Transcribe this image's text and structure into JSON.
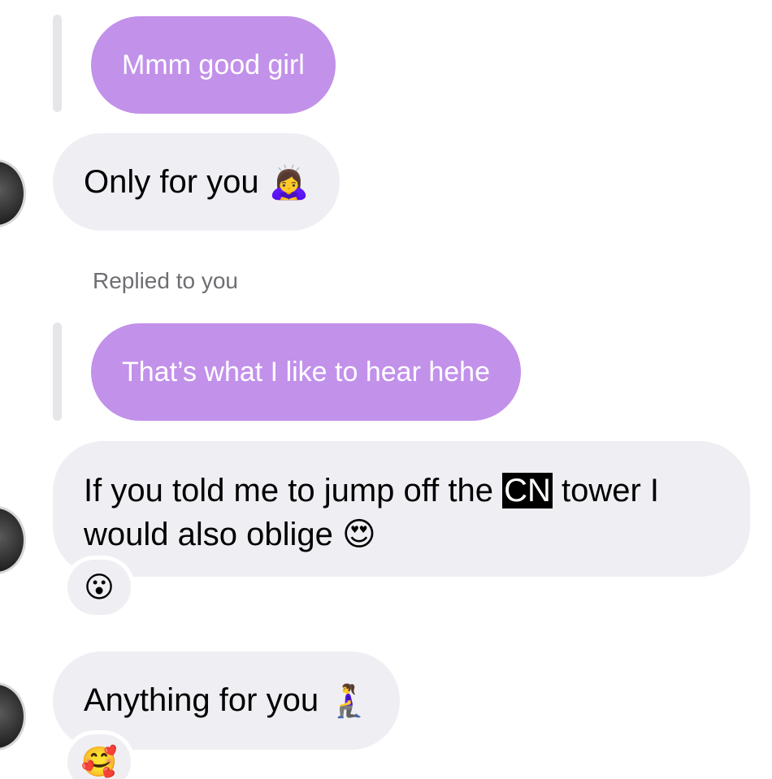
{
  "messages": {
    "quoted_1": {
      "text": "Mmm good girl"
    },
    "incoming_1": {
      "text": "Only for you",
      "emoji": "🙇‍♀️"
    },
    "reply_label": "Replied to you",
    "quoted_2": {
      "text": "That’s what I like to hear hehe"
    },
    "incoming_2": {
      "text_before": "If you told me to jump off the ",
      "highlight": "CN",
      "text_after": " tower I would also oblige ",
      "emoji": "😍",
      "reaction": "😮"
    },
    "incoming_3": {
      "text": "Anything for you",
      "emoji": "🧎‍♀️",
      "reaction": "🥰"
    }
  },
  "colors": {
    "quoted_bubble": "#c291ea",
    "incoming_bubble": "#efeff3",
    "meta_text": "#6e6e73"
  }
}
